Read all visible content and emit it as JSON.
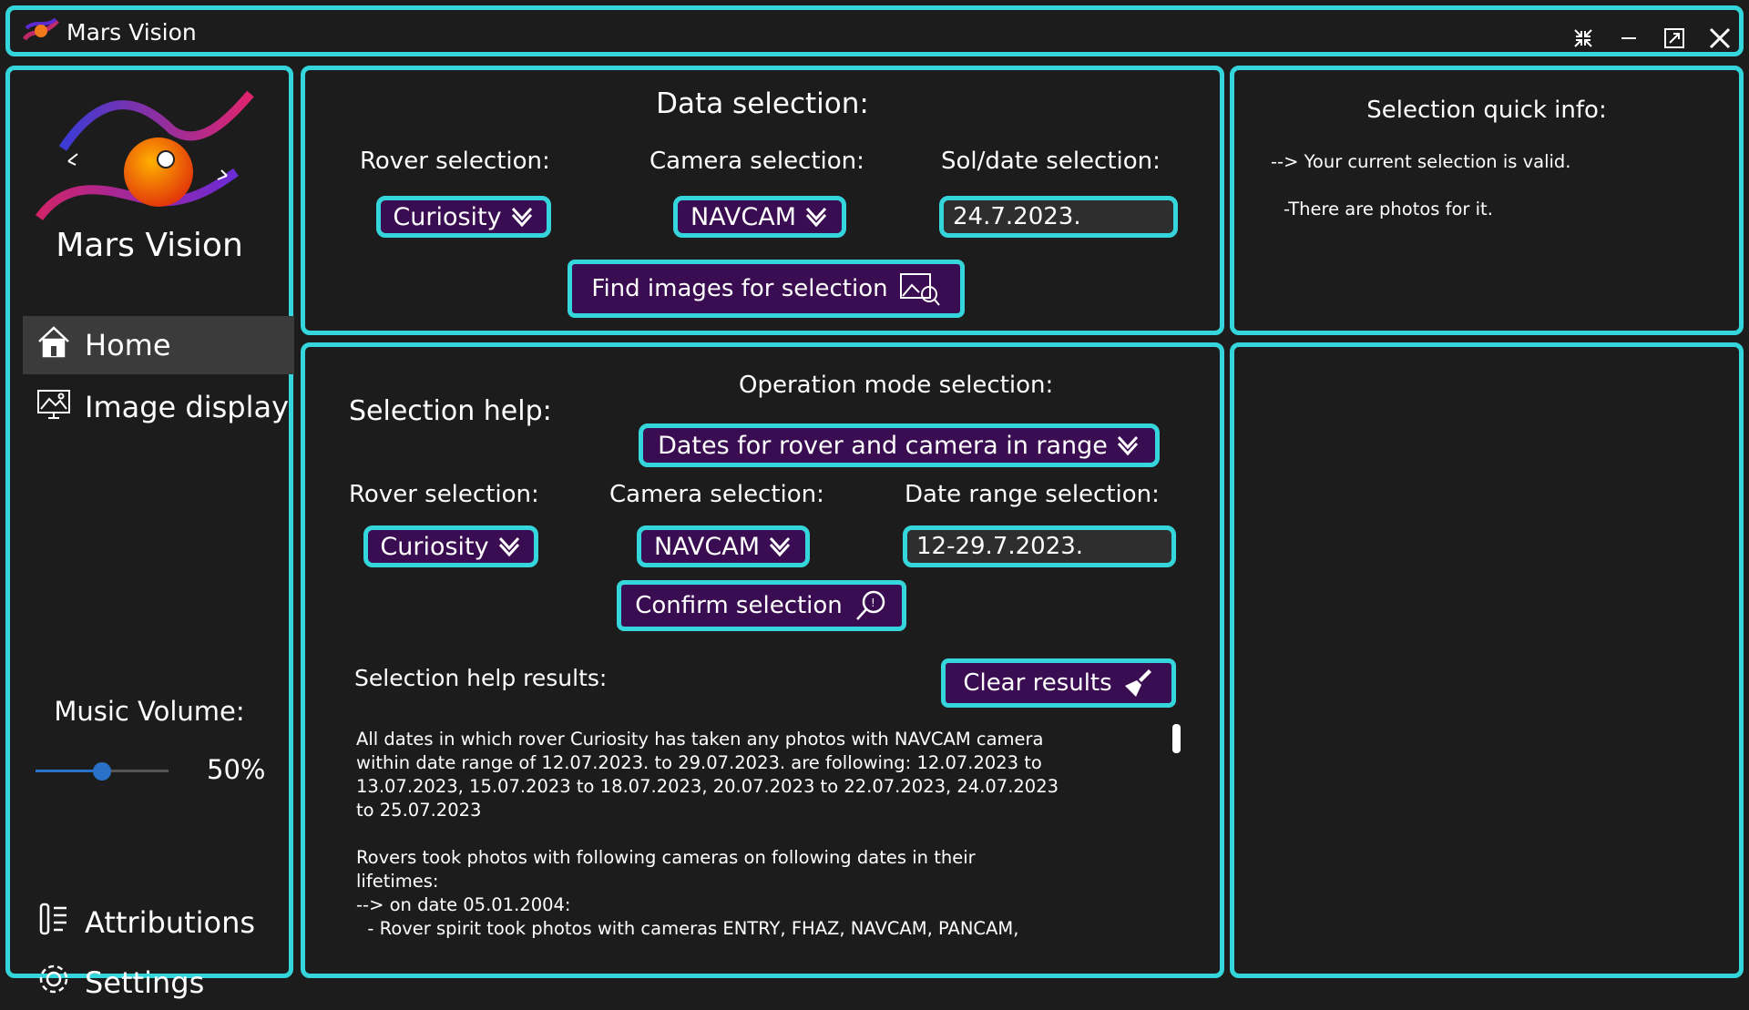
{
  "app": {
    "title": "Mars Vision"
  },
  "window_controls": [
    "collapse-icon",
    "minimize-icon",
    "restore-icon",
    "close-icon"
  ],
  "colors": {
    "accent": "#34d6dc",
    "button_bg": "#3a0d52",
    "background": "#1c1c1c",
    "active_nav": "#3b3b3b"
  },
  "sidebar": {
    "brand": "Mars Vision",
    "nav": [
      {
        "label": "Home",
        "icon": "home-icon",
        "active": true
      },
      {
        "label": "Image display",
        "icon": "image-display-icon",
        "active": false
      }
    ],
    "volume": {
      "label": "Music Volume:",
      "value_text": "50%",
      "value": 0.5
    },
    "bottom_nav": [
      {
        "label": "Attributions",
        "icon": "attributions-icon"
      },
      {
        "label": "Settings",
        "icon": "settings-icon"
      }
    ]
  },
  "data_selection": {
    "title": "Data selection:",
    "rover_label": "Rover selection:",
    "rover_value": "Curiosity",
    "camera_label": "Camera selection:",
    "camera_value": "NAVCAM",
    "date_label": "Sol/date selection:",
    "date_value": "24.7.2023.",
    "find_button": "Find images for selection"
  },
  "quick_info": {
    "title": "Selection quick info:",
    "line1": "--> Your current selection is valid.",
    "line2": "-There are photos for it."
  },
  "selection_help": {
    "title": "Selection help:",
    "mode_label": "Operation mode selection:",
    "mode_value": "Dates for rover and camera in range",
    "rover_label": "Rover selection:",
    "rover_value": "Curiosity",
    "camera_label": "Camera selection:",
    "camera_value": "NAVCAM",
    "date_label": "Date range selection:",
    "date_value": "12-29.7.2023.",
    "confirm_button": "Confirm selection",
    "results_label": "Selection help results:",
    "clear_button": "Clear results",
    "results_text": "All dates in which rover Curiosity has taken any photos with NAVCAM camera\nwithin date range of 12.07.2023. to 29.07.2023. are following: 12.07.2023 to\n13.07.2023, 15.07.2023 to 18.07.2023, 20.07.2023 to 22.07.2023, 24.07.2023\nto 25.07.2023\n\nRovers took photos with following cameras on following dates in their\nlifetimes:\n--> on date 05.01.2004:\n  - Rover spirit took photos with cameras ENTRY, FHAZ, NAVCAM, PANCAM,"
  }
}
